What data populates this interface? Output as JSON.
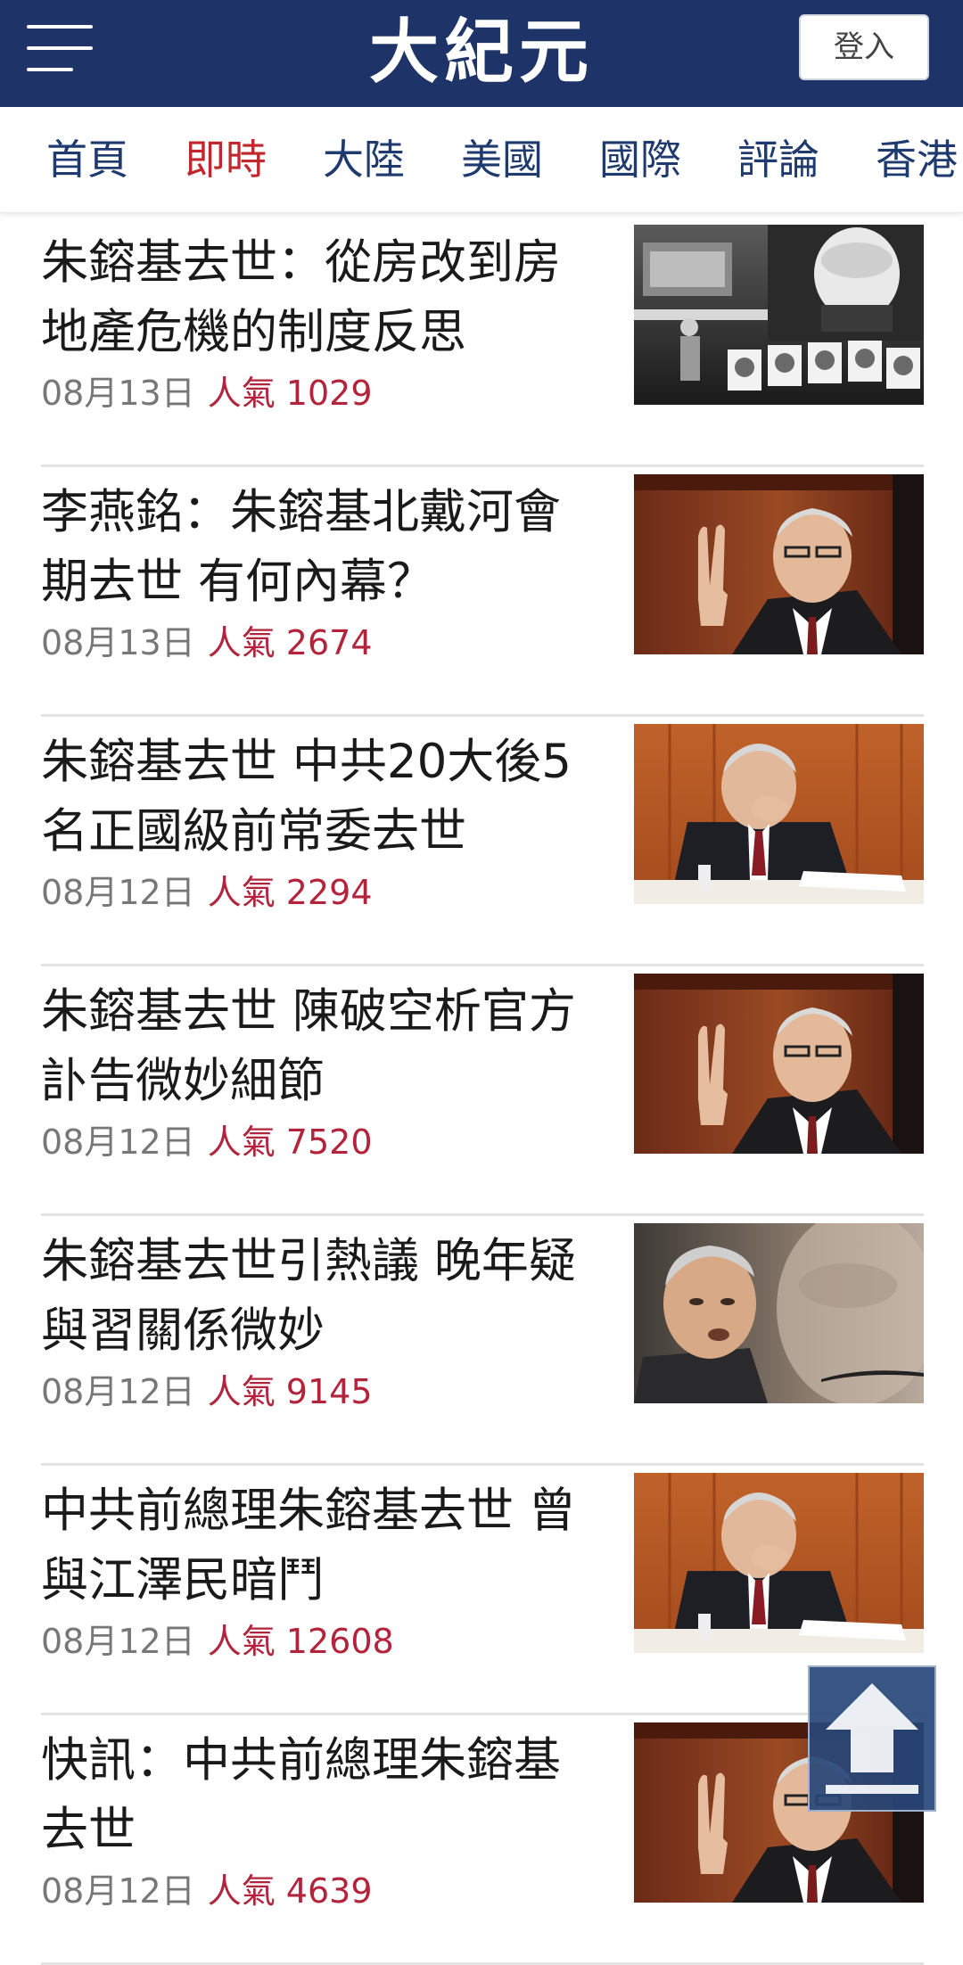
{
  "header": {
    "logo_text": "大紀元",
    "login_label": "登入",
    "bg_color": "#1e3468"
  },
  "tabs": [
    {
      "label": "首頁",
      "active": false
    },
    {
      "label": "即時",
      "active": true
    },
    {
      "label": "大陸",
      "active": false
    },
    {
      "label": "美國",
      "active": false
    },
    {
      "label": "國際",
      "active": false
    },
    {
      "label": "評論",
      "active": false
    },
    {
      "label": "香港",
      "active": false
    }
  ],
  "articles": [
    {
      "title": "朱鎔基去世：從房改到房地產危機的制度反思",
      "date": "08月13日",
      "popularity": "人氣 1029",
      "thumb": "bw-street"
    },
    {
      "title": "李燕銘：朱鎔基北戴河會期去世 有何內幕？",
      "date": "08月13日",
      "popularity": "人氣 2674",
      "thumb": "raised-hand"
    },
    {
      "title": "朱鎔基去世 中共20大後5名正國級前常委去世",
      "date": "08月12日",
      "popularity": "人氣 2294",
      "thumb": "seated-desk"
    },
    {
      "title": "朱鎔基去世 陳破空析官方訃告微妙細節",
      "date": "08月12日",
      "popularity": "人氣 7520",
      "thumb": "raised-hand"
    },
    {
      "title": "朱鎔基去世引熱議 晚年疑與習關係微妙",
      "date": "08月12日",
      "popularity": "人氣 9145",
      "thumb": "portrait-closeup"
    },
    {
      "title": "中共前總理朱鎔基去世 曾與江澤民暗鬥",
      "date": "08月12日",
      "popularity": "人氣 12608",
      "thumb": "seated-desk"
    },
    {
      "title": "快訊：中共前總理朱鎔基去世",
      "date": "08月12日",
      "popularity": "人氣 4639",
      "thumb": "raised-hand"
    }
  ],
  "colors": {
    "active_tab": "#c0282d",
    "tab": "#1f3a6e",
    "popularity": "#b3233b",
    "date": "#777777"
  },
  "icons": {
    "menu": "hamburger-icon",
    "back_to_top": "arrow-up-icon"
  }
}
